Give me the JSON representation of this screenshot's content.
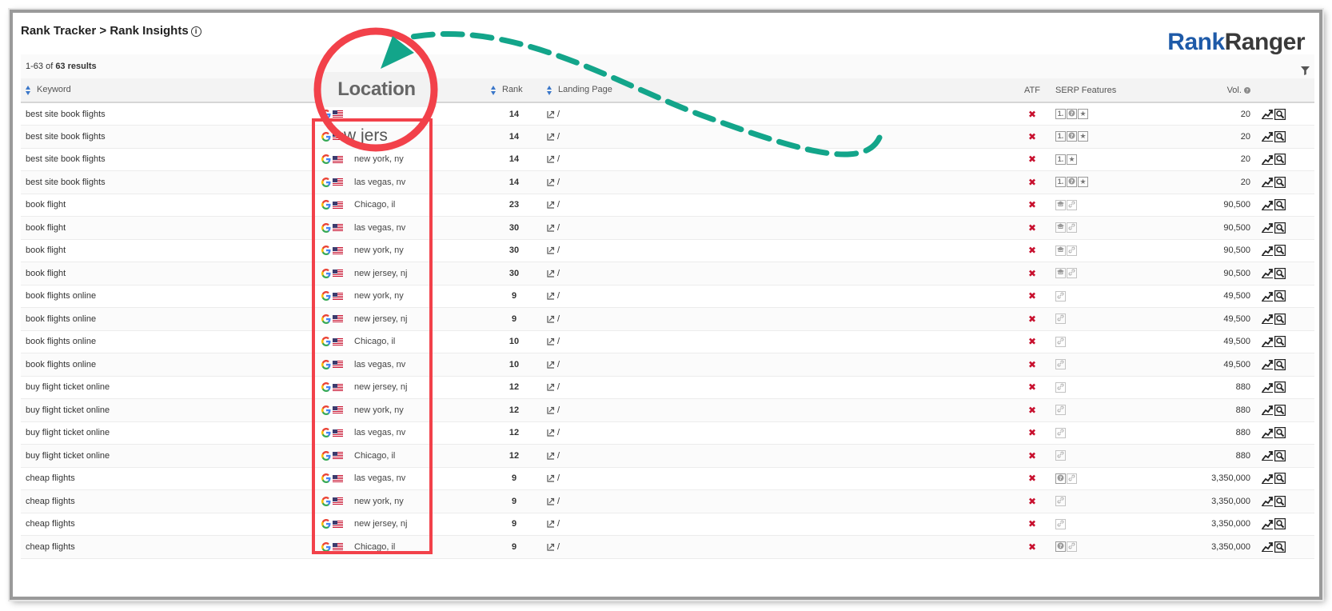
{
  "header": {
    "breadcrumb": "Rank Tracker > Rank Insights",
    "info_icon": "info-icon",
    "logo_part1": "Rank",
    "logo_part2": "Ranger",
    "results_range": "1-63 of",
    "results_count": "63 results"
  },
  "columns": {
    "keyword": "Keyword",
    "location": "Location",
    "rank": "Rank",
    "landing_page": "Landing Page",
    "atf": "ATF",
    "serp_features": "SERP Features",
    "vol": "Vol."
  },
  "annotation": {
    "location_label": "Location",
    "zoom_text": "w jers",
    "highlight_color": "#f2414a",
    "arrow_color": "#13a58a"
  },
  "rows": [
    {
      "keyword": "best site book flights",
      "location": "",
      "rank": "14",
      "landing": "/",
      "atf": "✖",
      "serp": [
        "1.",
        "faq",
        "star"
      ],
      "vol": "20"
    },
    {
      "keyword": "best site book flights",
      "location": "",
      "rank": "14",
      "landing": "/",
      "atf": "✖",
      "serp": [
        "1.",
        "faq",
        "star"
      ],
      "vol": "20"
    },
    {
      "keyword": "best site book flights",
      "location": "new york, ny",
      "rank": "14",
      "landing": "/",
      "atf": "✖",
      "serp": [
        "1.",
        "star"
      ],
      "vol": "20"
    },
    {
      "keyword": "best site book flights",
      "location": "las vegas, nv",
      "rank": "14",
      "landing": "/",
      "atf": "✖",
      "serp": [
        "1.",
        "faq",
        "star"
      ],
      "vol": "20"
    },
    {
      "keyword": "book flight",
      "location": "Chicago, il",
      "rank": "23",
      "landing": "/",
      "atf": "✖",
      "serp": [
        "edu",
        "link"
      ],
      "vol": "90,500"
    },
    {
      "keyword": "book flight",
      "location": "las vegas, nv",
      "rank": "30",
      "landing": "/",
      "atf": "✖",
      "serp": [
        "edu",
        "link"
      ],
      "vol": "90,500"
    },
    {
      "keyword": "book flight",
      "location": "new york, ny",
      "rank": "30",
      "landing": "/",
      "atf": "✖",
      "serp": [
        "edu",
        "link"
      ],
      "vol": "90,500"
    },
    {
      "keyword": "book flight",
      "location": "new jersey, nj",
      "rank": "30",
      "landing": "/",
      "atf": "✖",
      "serp": [
        "edu",
        "link"
      ],
      "vol": "90,500"
    },
    {
      "keyword": "book flights online",
      "location": "new york, ny",
      "rank": "9",
      "landing": "/",
      "atf": "✖",
      "serp": [
        "link"
      ],
      "vol": "49,500"
    },
    {
      "keyword": "book flights online",
      "location": "new jersey, nj",
      "rank": "9",
      "landing": "/",
      "atf": "✖",
      "serp": [
        "link"
      ],
      "vol": "49,500"
    },
    {
      "keyword": "book flights online",
      "location": "Chicago, il",
      "rank": "10",
      "landing": "/",
      "atf": "✖",
      "serp": [
        "link"
      ],
      "vol": "49,500"
    },
    {
      "keyword": "book flights online",
      "location": "las vegas, nv",
      "rank": "10",
      "landing": "/",
      "atf": "✖",
      "serp": [
        "link"
      ],
      "vol": "49,500"
    },
    {
      "keyword": "buy flight ticket online",
      "location": "new jersey, nj",
      "rank": "12",
      "landing": "/",
      "atf": "✖",
      "serp": [
        "link"
      ],
      "vol": "880"
    },
    {
      "keyword": "buy flight ticket online",
      "location": "new york, ny",
      "rank": "12",
      "landing": "/",
      "atf": "✖",
      "serp": [
        "link"
      ],
      "vol": "880"
    },
    {
      "keyword": "buy flight ticket online",
      "location": "las vegas, nv",
      "rank": "12",
      "landing": "/",
      "atf": "✖",
      "serp": [
        "link"
      ],
      "vol": "880"
    },
    {
      "keyword": "buy flight ticket online",
      "location": "Chicago, il",
      "rank": "12",
      "landing": "/",
      "atf": "✖",
      "serp": [
        "link"
      ],
      "vol": "880"
    },
    {
      "keyword": "cheap flights",
      "location": "las vegas, nv",
      "rank": "9",
      "landing": "/",
      "atf": "✖",
      "serp": [
        "faq",
        "link"
      ],
      "vol": "3,350,000"
    },
    {
      "keyword": "cheap flights",
      "location": "new york, ny",
      "rank": "9",
      "landing": "/",
      "atf": "✖",
      "serp": [
        "link"
      ],
      "vol": "3,350,000"
    },
    {
      "keyword": "cheap flights",
      "location": "new jersey, nj",
      "rank": "9",
      "landing": "/",
      "atf": "✖",
      "serp": [
        "link"
      ],
      "vol": "3,350,000"
    },
    {
      "keyword": "cheap flights",
      "location": "Chicago, il",
      "rank": "9",
      "landing": "/",
      "atf": "✖",
      "serp": [
        "faq",
        "link"
      ],
      "vol": "3,350,000"
    }
  ]
}
